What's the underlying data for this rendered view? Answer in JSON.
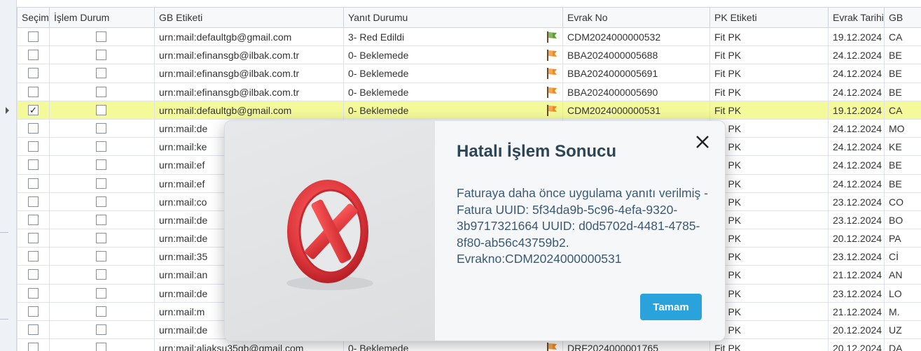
{
  "grid": {
    "columns": [
      "Seçim",
      "İşlem Durum",
      "GB Etiketi",
      "Yanıt Durumu",
      "Evrak No",
      "PK Etiketi",
      "Evrak Tarihi",
      "GB"
    ],
    "rows": [
      {
        "checked": false,
        "gb": "urn:mail:defaultgb@gmail.com",
        "yanit": "3- Red Edildi",
        "flag": "green",
        "evrak": "CDM2024000000532",
        "pk": "Fit PK",
        "tarih": "19.12.2024",
        "gb2": "CA"
      },
      {
        "checked": false,
        "gb": "urn:mail:efinansgb@ilbak.com.tr",
        "yanit": "0- Beklemede",
        "flag": "orange",
        "evrak": "BBA2024000005688",
        "pk": "Fit PK",
        "tarih": "24.12.2024",
        "gb2": "BE"
      },
      {
        "checked": false,
        "gb": "urn:mail:efinansgb@ilbak.com.tr",
        "yanit": "0- Beklemede",
        "flag": "orange",
        "evrak": "BBA2024000005691",
        "pk": "Fit PK",
        "tarih": "24.12.2024",
        "gb2": "BE"
      },
      {
        "checked": false,
        "gb": "urn:mail:efinansgb@ilbak.com.tr",
        "yanit": "0- Beklemede",
        "flag": "orange",
        "evrak": "BBA2024000005690",
        "pk": "Fit PK",
        "tarih": "24.12.2024",
        "gb2": "BE"
      },
      {
        "checked": true,
        "gb": "urn:mail:defaultgb@gmail.com",
        "yanit": "0- Beklemede",
        "flag": "orange",
        "evrak": "CDM2024000000531",
        "pk": "Fit PK",
        "tarih": "19.12.2024",
        "gb2": "CA"
      },
      {
        "checked": false,
        "gb": "urn:mail:de",
        "yanit": "",
        "flag": "",
        "evrak": "",
        "pk": "Fit PK",
        "tarih": "24.12.2024",
        "gb2": "MO"
      },
      {
        "checked": false,
        "gb": "urn:mail:ke",
        "yanit": "",
        "flag": "",
        "evrak": "",
        "pk": "Fit PK",
        "tarih": "24.12.2024",
        "gb2": "KE"
      },
      {
        "checked": false,
        "gb": "urn:mail:ef",
        "yanit": "",
        "flag": "",
        "evrak": "",
        "pk": "Fit PK",
        "tarih": "24.12.2024",
        "gb2": "BE"
      },
      {
        "checked": false,
        "gb": "urn:mail:ef",
        "yanit": "",
        "flag": "",
        "evrak": "",
        "pk": "Fit PK",
        "tarih": "24.12.2024",
        "gb2": "BE"
      },
      {
        "checked": false,
        "gb": "urn:mail:co",
        "yanit": "",
        "flag": "",
        "evrak": "",
        "pk": "Fit PK",
        "tarih": "23.12.2024",
        "gb2": "CO"
      },
      {
        "checked": false,
        "gb": "urn:mail:de",
        "yanit": "",
        "flag": "",
        "evrak": "",
        "pk": "Fit PK",
        "tarih": "23.12.2024",
        "gb2": "BO"
      },
      {
        "checked": false,
        "gb": "urn:mail:de",
        "yanit": "",
        "flag": "",
        "evrak": "",
        "pk": "Fit PK",
        "tarih": "20.12.2024",
        "gb2": "PA"
      },
      {
        "checked": false,
        "gb": "urn:mail:35",
        "yanit": "",
        "flag": "",
        "evrak": "",
        "pk": "Fit PK",
        "tarih": "23.12.2024",
        "gb2": "Cİ"
      },
      {
        "checked": false,
        "gb": "urn:mail:an",
        "yanit": "",
        "flag": "",
        "evrak": "",
        "pk": "Fit PK",
        "tarih": "21.12.2024",
        "gb2": "AN"
      },
      {
        "checked": false,
        "gb": "urn:mail:de",
        "yanit": "",
        "flag": "",
        "evrak": "",
        "pk": "Fit PK",
        "tarih": "23.12.2024",
        "gb2": "LO"
      },
      {
        "checked": false,
        "gb": "urn:mail:m",
        "yanit": "",
        "flag": "",
        "evrak": "",
        "pk": "Fit PK",
        "tarih": "21.12.2024",
        "gb2": "M."
      },
      {
        "checked": false,
        "gb": "urn:mail:de",
        "yanit": "",
        "flag": "",
        "evrak": "",
        "pk": "Fit PK",
        "tarih": "20.12.2024",
        "gb2": "UZ"
      },
      {
        "checked": false,
        "gb": "urn:mail:aliaksu35gb@gmail.com",
        "yanit": "0- Beklemede",
        "flag": "orange",
        "evrak": "DRF2024000001765",
        "pk": "Fit PK",
        "tarih": "20.12.2024",
        "gb2": "DA"
      }
    ],
    "selected_row_index": 4
  },
  "dialog": {
    "title": "Hatalı İşlem Sonucu",
    "message": "Faturaya daha önce uygulama yanıtı verilmiş - Fatura UUID: 5f34da9b-5c96-4efa-9320-3b9717321664 UUID: d0d5702d-4481-4785-8f80-ab56c43759b2. Evrakno:CDM2024000000531",
    "ok_label": "Tamam",
    "close_glyph": "✕",
    "icon": "error-x-icon"
  },
  "colors": {
    "selected_row": "#f4fa9a",
    "button": "#2aa3dc",
    "title": "#2e4556",
    "message": "#3b5a74",
    "error_red": "#e0393e",
    "flag_green": "#5da02e",
    "flag_orange": "#f08a1c"
  }
}
